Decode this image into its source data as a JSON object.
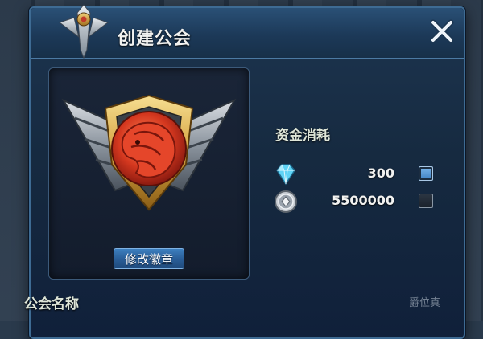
{
  "dialog": {
    "title": "创建公会",
    "close_icon": "close-x-icon",
    "title_icon": "guild-crest-icon"
  },
  "badge": {
    "icon": "lion-shield-badge",
    "change_button": "修改徽章"
  },
  "cost": {
    "title": "资金消耗",
    "options": [
      {
        "icon": "diamond-icon",
        "amount": "300",
        "checked": true
      },
      {
        "icon": "silver-coin-icon",
        "amount": "5500000",
        "checked": false
      }
    ]
  },
  "guild_name": {
    "label": "公会名称"
  },
  "watermark": "爵位真"
}
